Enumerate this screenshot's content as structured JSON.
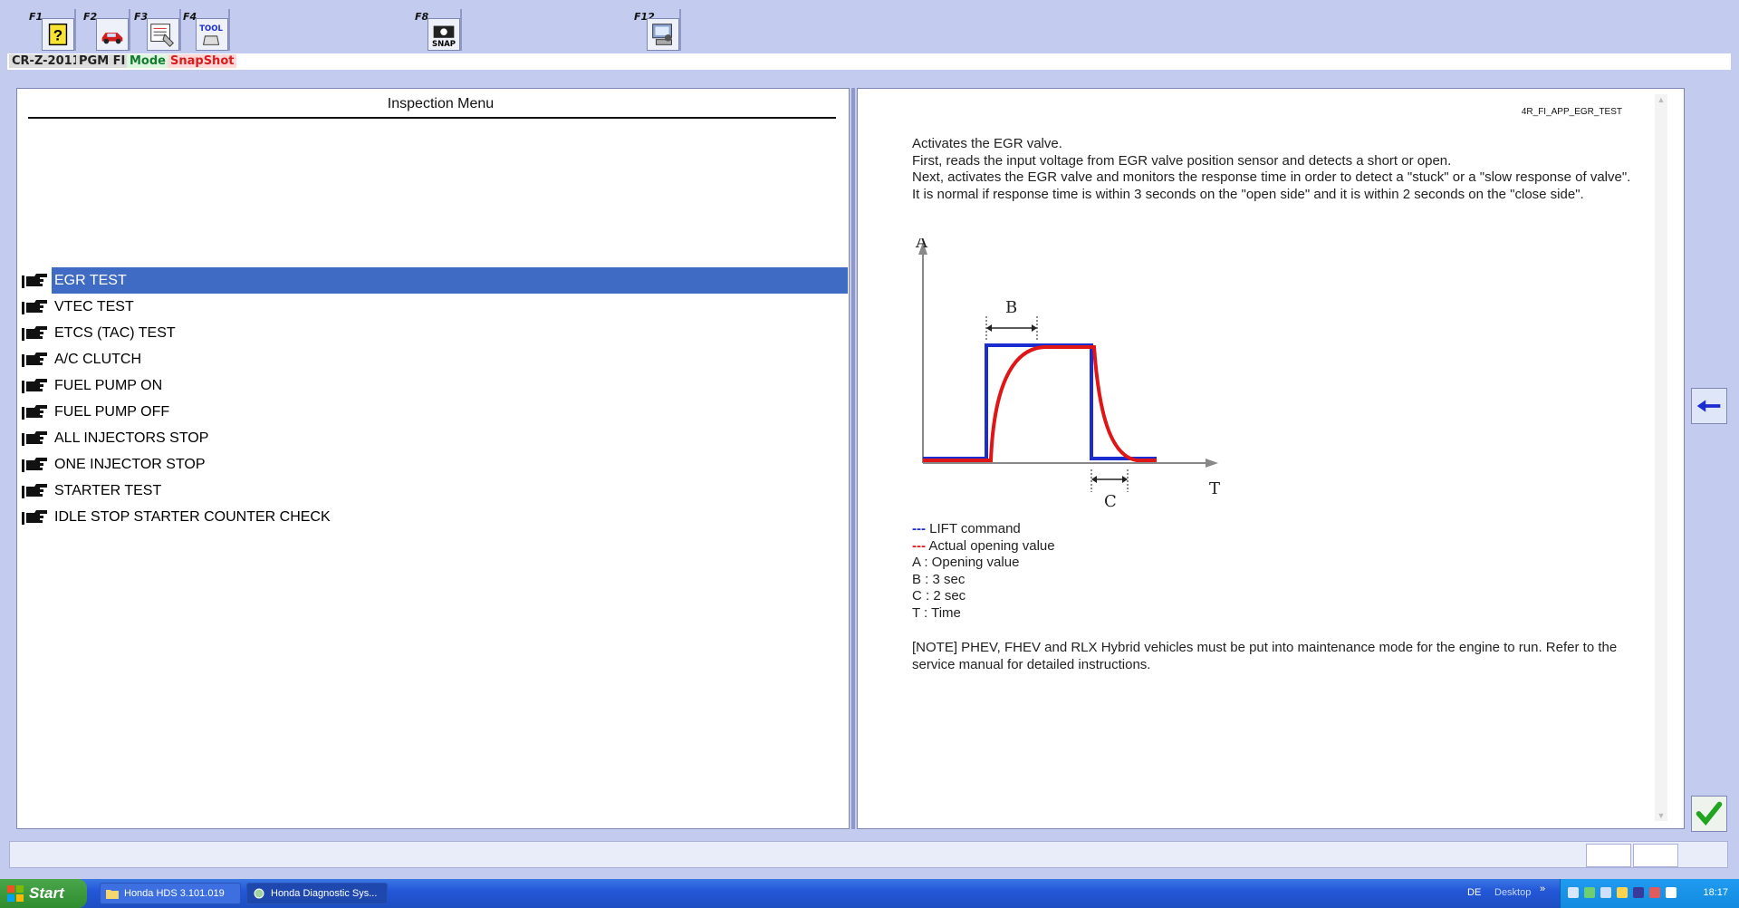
{
  "toolbar": {
    "keys": [
      {
        "key": "F1",
        "icon": "help-icon"
      },
      {
        "key": "F2",
        "icon": "car-icon"
      },
      {
        "key": "F3",
        "icon": "data-list-icon"
      },
      {
        "key": "F4",
        "icon": "tool-icon",
        "icon_text": "TOOL"
      },
      {
        "key": "F8",
        "icon": "snapshot-camera-icon",
        "icon_text": "SNAP"
      },
      {
        "key": "F12",
        "icon": "computer-settings-icon"
      }
    ]
  },
  "status": {
    "model": "CR-Z-2011",
    "system": "PGM FI",
    "mode": "Mode",
    "snapshot": "SnapShot"
  },
  "menu": {
    "title": "Inspection Menu",
    "items": [
      {
        "label": "EGR TEST",
        "selected": true
      },
      {
        "label": "VTEC TEST"
      },
      {
        "label": "ETCS (TAC) TEST"
      },
      {
        "label": "A/C CLUTCH"
      },
      {
        "label": "FUEL PUMP ON"
      },
      {
        "label": "FUEL PUMP OFF"
      },
      {
        "label": "ALL INJECTORS STOP"
      },
      {
        "label": "ONE INJECTOR STOP"
      },
      {
        "label": "STARTER TEST"
      },
      {
        "label": "IDLE STOP STARTER COUNTER CHECK"
      }
    ]
  },
  "doc": {
    "id": "4R_FI_APP_EGR_TEST",
    "para1": "Activates the EGR valve.",
    "para2": "First, reads the input voltage from EGR valve position sensor and detects a short or open.",
    "para3": "Next, activates the EGR valve and monitors the response time in order to detect a \"stuck\" or a \"slow response of valve\". It is normal if response time is within 3 seconds on the \"open side\" and it is within 2 seconds on the \"close side\".",
    "graph": {
      "label_a": "A",
      "label_b": "B",
      "label_c": "C",
      "label_t": "T",
      "command_color": "#1b2cd1",
      "actual_color": "#e01515"
    },
    "legend": {
      "dash": "---",
      "lift": "LIFT command",
      "actual": "Actual opening value",
      "a": "A : Opening value",
      "b": "B : 3 sec",
      "c": "C : 2 sec",
      "t": "T : Time"
    },
    "note": "[NOTE] PHEV, FHEV and RLX Hybrid vehicles must be put into maintenance mode for the engine to run. Refer to the service manual for detailed instructions."
  },
  "buttons": {
    "back_icon": "back-arrow-icon",
    "ok_icon": "checkmark-icon"
  },
  "taskbar": {
    "start": "Start",
    "items": [
      {
        "label": "Honda HDS 3.101.019",
        "icon": "folder-icon"
      },
      {
        "label": "Honda Diagnostic Sys...",
        "icon": "hds-app-icon"
      }
    ],
    "lang": "DE",
    "desktop": "Desktop",
    "chevron": "»",
    "clock": "18:17"
  }
}
